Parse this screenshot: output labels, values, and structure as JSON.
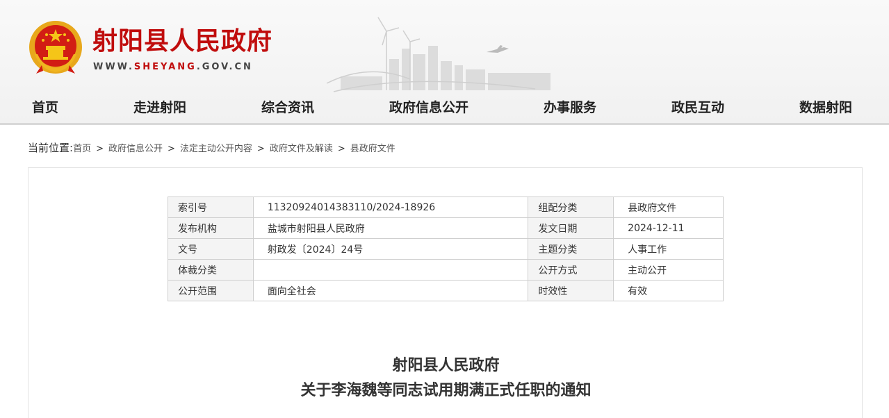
{
  "header": {
    "site_title": "射阳县人民政府",
    "url_prefix": "WWW.",
    "url_domain": "SHEYANG",
    "url_suffix": ".GOV.CN",
    "emblem_icon": "national-emblem-icon",
    "brand_color": "#c00d0d"
  },
  "nav": {
    "items": [
      "首页",
      "走进射阳",
      "综合资讯",
      "政府信息公开",
      "办事服务",
      "政民互动",
      "数据射阳"
    ]
  },
  "breadcrumb": {
    "lead": "当前位置:",
    "items": [
      "首页",
      "政府信息公开",
      "法定主动公开内容",
      "政府文件及解读",
      "县政府文件"
    ]
  },
  "meta": {
    "rows": [
      {
        "k1": "索引号",
        "v1": "11320924014383110/2024-18926",
        "k2": "组配分类",
        "v2": "县政府文件"
      },
      {
        "k1": "发布机构",
        "v1": "盐城市射阳县人民政府",
        "k2": "发文日期",
        "v2": "2024-12-11"
      },
      {
        "k1": "文号",
        "v1": "射政发〔2024〕24号",
        "k2": "主题分类",
        "v2": "人事工作"
      },
      {
        "k1": "体裁分类",
        "v1": "",
        "k2": "公开方式",
        "v2": "主动公开"
      },
      {
        "k1": "公开范围",
        "v1": "面向全社会",
        "k2": "时效性",
        "v2": "有效"
      }
    ]
  },
  "document": {
    "title_line1": "射阳县人民政府",
    "title_line2": "关于李海魏等同志试用期满正式任职的通知"
  }
}
